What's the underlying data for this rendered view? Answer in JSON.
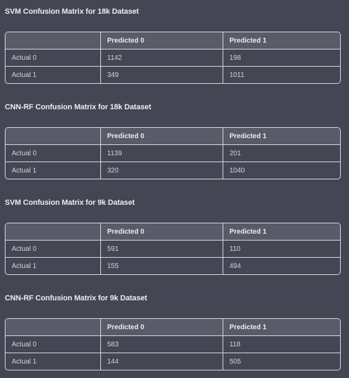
{
  "matrices": [
    {
      "title": "SVM Confusion Matrix for 18k Dataset",
      "headers": [
        "",
        "Predicted 0",
        "Predicted 1"
      ],
      "rows": [
        {
          "label": "Actual 0",
          "p0": "1142",
          "p1": "198"
        },
        {
          "label": "Actual 1",
          "p0": "349",
          "p1": "1011"
        }
      ]
    },
    {
      "title": "CNN-RF Confusion Matrix for 18k Dataset",
      "headers": [
        "",
        "Predicted 0",
        "Predicted 1"
      ],
      "rows": [
        {
          "label": "Actual 0",
          "p0": "1139",
          "p1": "201"
        },
        {
          "label": "Actual 1",
          "p0": "320",
          "p1": "1040"
        }
      ]
    },
    {
      "title": "SVM Confusion Matrix for 9k Dataset",
      "headers": [
        "",
        "Predicted 0",
        "Predicted 1"
      ],
      "rows": [
        {
          "label": "Actual 0",
          "p0": "591",
          "p1": "110"
        },
        {
          "label": "Actual 1",
          "p0": "155",
          "p1": "494"
        }
      ]
    },
    {
      "title": "CNN-RF Confusion Matrix for 9k Dataset",
      "headers": [
        "",
        "Predicted 0",
        "Predicted 1"
      ],
      "rows": [
        {
          "label": "Actual 0",
          "p0": "583",
          "p1": "118"
        },
        {
          "label": "Actual 1",
          "p0": "144",
          "p1": "505"
        }
      ]
    }
  ]
}
